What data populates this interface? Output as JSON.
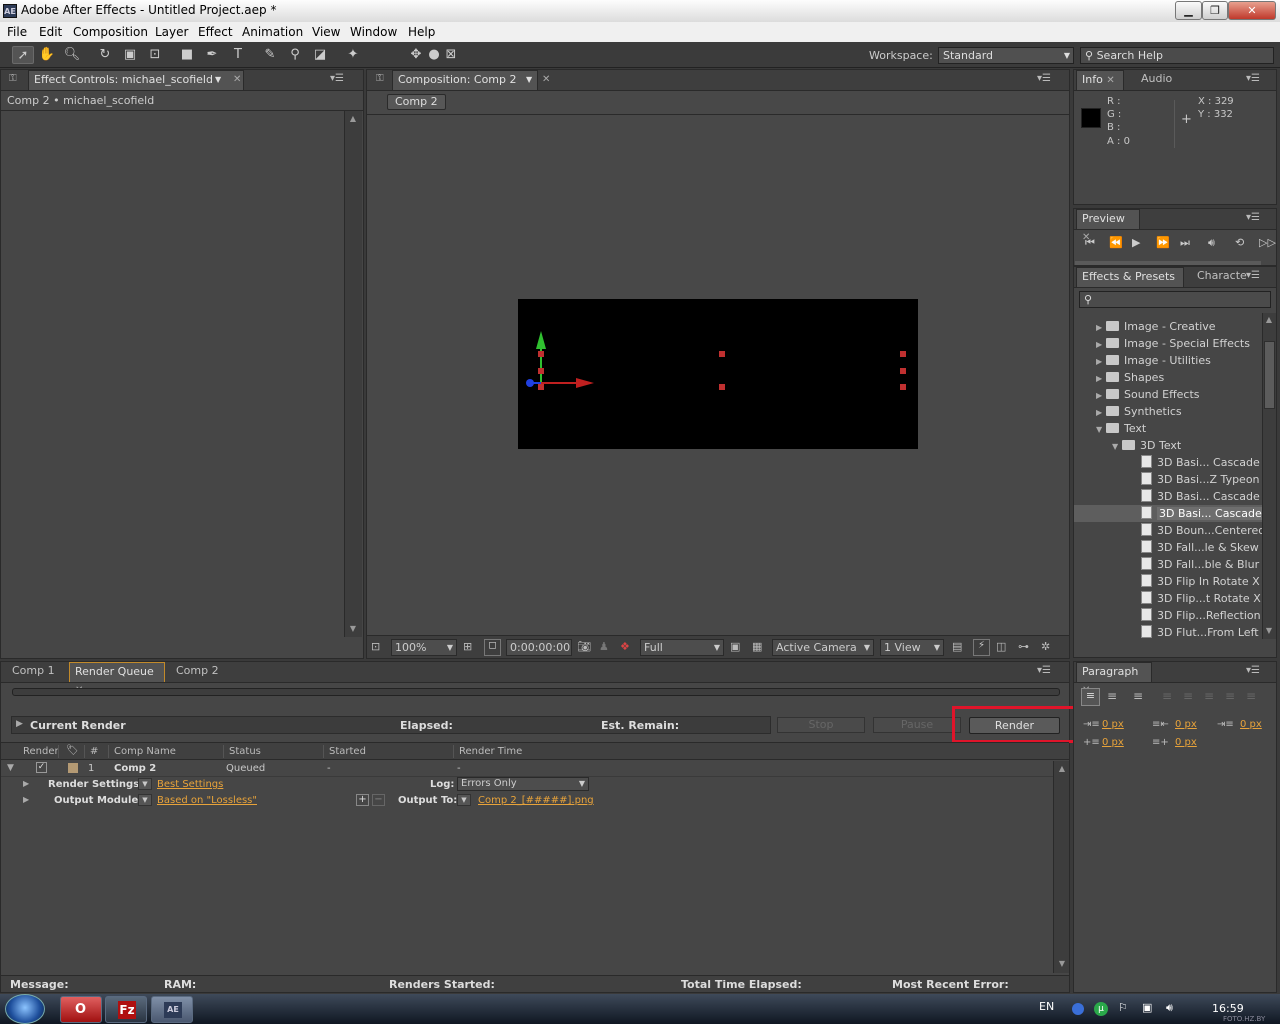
{
  "window": {
    "title": "Adobe After Effects - Untitled Project.aep *",
    "app_icon_text": "AE",
    "min": "▁",
    "max": "❐",
    "close": "✕"
  },
  "menu": [
    "File",
    "Edit",
    "Composition",
    "Layer",
    "Effect",
    "Animation",
    "View",
    "Window",
    "Help"
  ],
  "toolbar": {
    "workspace_label": "Workspace:",
    "workspace_value": "Standard",
    "search_placeholder": "Search Help"
  },
  "effect_controls": {
    "tab": "Effect Controls: michael_scofield",
    "breadcrumb": "Comp 2 • michael_scofield"
  },
  "composition": {
    "tab": "Composition: Comp 2",
    "sub_tab": "Comp 2",
    "zoom": "100%",
    "timecode": "0:00:00:00",
    "resolution": "Full",
    "camera": "Active Camera",
    "views": "1 View"
  },
  "info": {
    "tabs": [
      "Info",
      "Audio"
    ],
    "r": "R :",
    "g": "G :",
    "b": "B :",
    "a": "A : 0",
    "x": "X : 329",
    "y": "Y : 332"
  },
  "preview": {
    "tab": "Preview"
  },
  "effects": {
    "tabs": [
      "Effects & Presets",
      "Characte"
    ],
    "items": [
      {
        "label": "Image - Creative",
        "type": "folder",
        "indent": 0,
        "expanded": false
      },
      {
        "label": "Image - Special Effects",
        "type": "folder",
        "indent": 0,
        "expanded": false
      },
      {
        "label": "Image - Utilities",
        "type": "folder",
        "indent": 0,
        "expanded": false
      },
      {
        "label": "Shapes",
        "type": "folder",
        "indent": 0,
        "expanded": false
      },
      {
        "label": "Sound Effects",
        "type": "folder",
        "indent": 0,
        "expanded": false
      },
      {
        "label": "Synthetics",
        "type": "folder",
        "indent": 0,
        "expanded": false
      },
      {
        "label": "Text",
        "type": "folder",
        "indent": 0,
        "expanded": true
      },
      {
        "label": "3D Text",
        "type": "folder",
        "indent": 1,
        "expanded": true
      },
      {
        "label": "3D Basi... Cascade",
        "type": "preset",
        "indent": 2
      },
      {
        "label": "3D Basi...Z Typeon",
        "type": "preset",
        "indent": 2
      },
      {
        "label": "3D Basi... Cascade",
        "type": "preset",
        "indent": 2
      },
      {
        "label": "3D Basi... Cascade",
        "type": "preset",
        "indent": 2,
        "selected": true
      },
      {
        "label": "3D Boun...Centered",
        "type": "preset",
        "indent": 2
      },
      {
        "label": "3D Fall...le & Skew",
        "type": "preset",
        "indent": 2
      },
      {
        "label": "3D Fall...ble & Blur",
        "type": "preset",
        "indent": 2
      },
      {
        "label": "3D Flip In Rotate X",
        "type": "preset",
        "indent": 2
      },
      {
        "label": "3D Flip...t Rotate X",
        "type": "preset",
        "indent": 2
      },
      {
        "label": "3D Flip...Reflection",
        "type": "preset",
        "indent": 2
      },
      {
        "label": "3D Flut...From Left",
        "type": "preset",
        "indent": 2
      }
    ]
  },
  "bottom_tabs": [
    "Comp 1",
    "Render Queue",
    "Comp 2"
  ],
  "render_queue": {
    "current_render": "Current Render",
    "elapsed": "Elapsed:",
    "est_remain": "Est. Remain:",
    "stop": "Stop",
    "pause": "Pause",
    "render": "Render",
    "columns": [
      "Render",
      "#",
      "Comp Name",
      "Status",
      "Started",
      "Render Time"
    ],
    "item": {
      "num": "1",
      "comp": "Comp 2",
      "status": "Queued",
      "started": "-",
      "render_time": "-",
      "render_settings_label": "Render Settings:",
      "render_settings_value": "Best Settings",
      "log_label": "Log:",
      "log_value": "Errors Only",
      "output_module_label": "Output Module:",
      "output_module_value": "Based on \"Lossless\"",
      "output_to_label": "Output To:",
      "output_to_value": "Comp 2_[#####].png"
    },
    "status_bar": {
      "message": "Message:",
      "ram": "RAM:",
      "renders_started": "Renders Started:",
      "total_time": "Total Time Elapsed:",
      "recent_error": "Most Recent Error:"
    }
  },
  "paragraph": {
    "tab": "Paragraph",
    "values": [
      "0 px",
      "0 px",
      "0 px",
      "0 px",
      "0 px"
    ]
  },
  "taskbar": {
    "lang": "EN",
    "time": "16:59",
    "watermark": "FOTO.HZ.BY"
  }
}
